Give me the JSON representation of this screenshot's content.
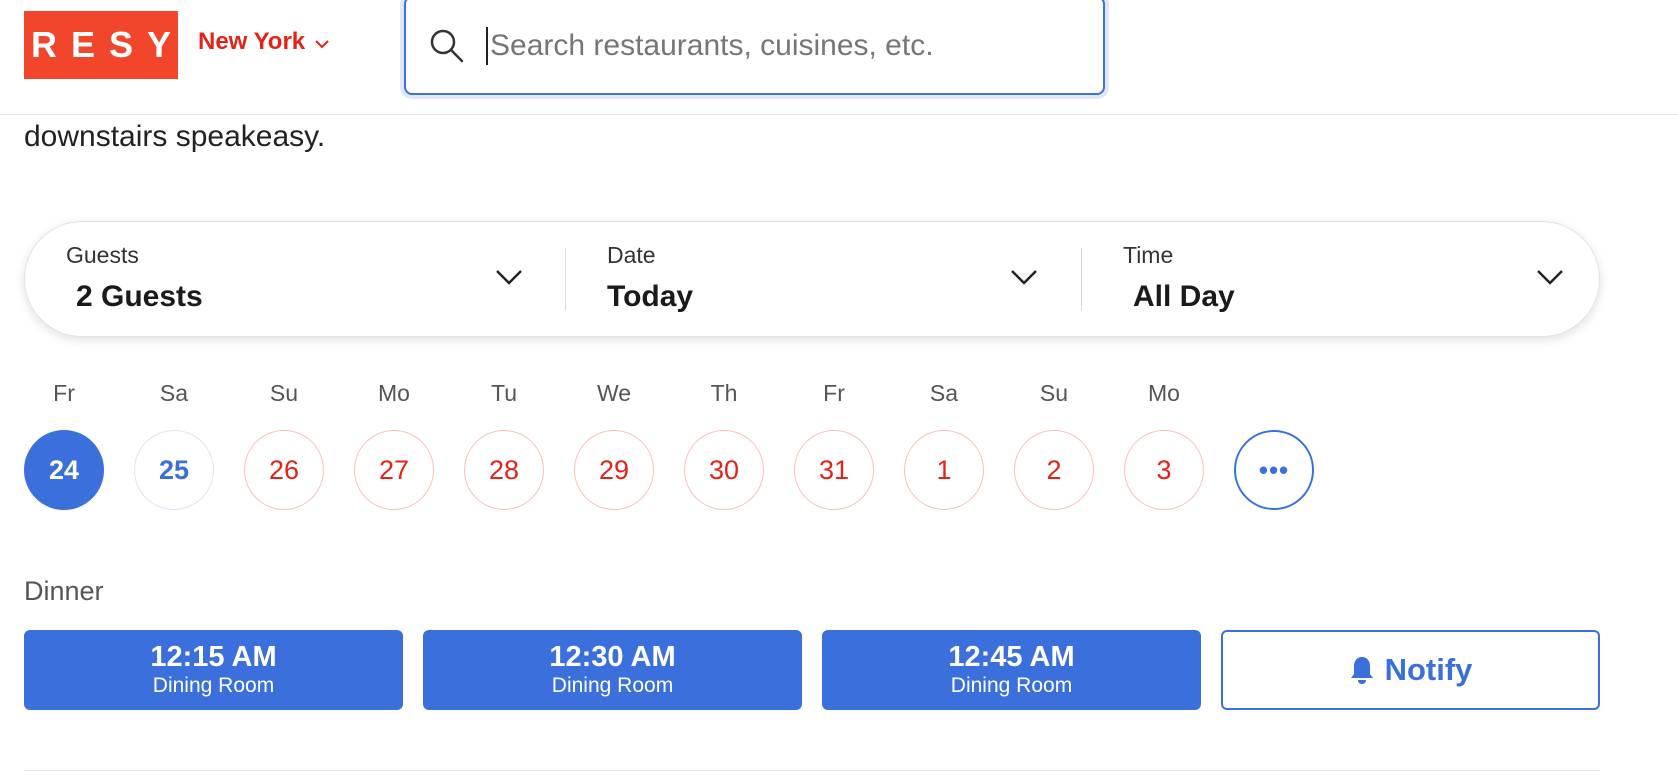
{
  "header": {
    "logo": "RESY",
    "city": "New York",
    "search_placeholder": "Search restaurants, cuisines, etc.",
    "brand_color": "#f1462c"
  },
  "description_tail": "downstairs speakeasy.",
  "selector": {
    "guests": {
      "label": "Guests",
      "value": "2 Guests"
    },
    "date": {
      "label": "Date",
      "value": "Today"
    },
    "time": {
      "label": "Time",
      "value": "All Day"
    }
  },
  "days": [
    {
      "name": "Fr",
      "num": "24",
      "state": "selected"
    },
    {
      "name": "Sa",
      "num": "25",
      "state": "available"
    },
    {
      "name": "Su",
      "num": "26",
      "state": "unavailable"
    },
    {
      "name": "Mo",
      "num": "27",
      "state": "unavailable"
    },
    {
      "name": "Tu",
      "num": "28",
      "state": "unavailable"
    },
    {
      "name": "We",
      "num": "29",
      "state": "unavailable"
    },
    {
      "name": "Th",
      "num": "30",
      "state": "unavailable"
    },
    {
      "name": "Fr",
      "num": "31",
      "state": "unavailable"
    },
    {
      "name": "Sa",
      "num": "1",
      "state": "unavailable"
    },
    {
      "name": "Su",
      "num": "2",
      "state": "unavailable"
    },
    {
      "name": "Mo",
      "num": "3",
      "state": "unavailable"
    }
  ],
  "more_dates": "•••",
  "meal": "Dinner",
  "slots": [
    {
      "time": "12:15 AM",
      "room": "Dining Room"
    },
    {
      "time": "12:30 AM",
      "room": "Dining Room"
    },
    {
      "time": "12:45 AM",
      "room": "Dining Room"
    }
  ],
  "notify_label": "Notify",
  "colors": {
    "accent": "#3a6fdc",
    "unavailable": "#e2231a"
  }
}
